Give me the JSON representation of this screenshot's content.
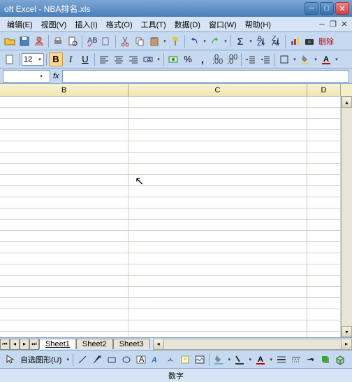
{
  "title": "oft Excel - NBA排名.xls",
  "menu": {
    "edit": "编辑(E)",
    "view": "视图(V)",
    "insert": "插入(I)",
    "format": "格式(O)",
    "tools": "工具(T)",
    "data": "数据(D)",
    "window": "窗口(W)",
    "help": "帮助(H)"
  },
  "toolbar": {
    "fontsize": "12",
    "delete_label": "删除"
  },
  "formula": {
    "fx": "fx"
  },
  "columns": {
    "B": "B",
    "C": "C",
    "D": "D"
  },
  "widths": {
    "rowhead": 0,
    "B": 184,
    "C": 256,
    "D": 48
  },
  "sheets": {
    "s1": "Sheet1",
    "s2": "Sheet2",
    "s3": "Sheet3"
  },
  "drawing": {
    "autoshape": "自选图形(U)"
  },
  "status": {
    "mode": "数字"
  }
}
